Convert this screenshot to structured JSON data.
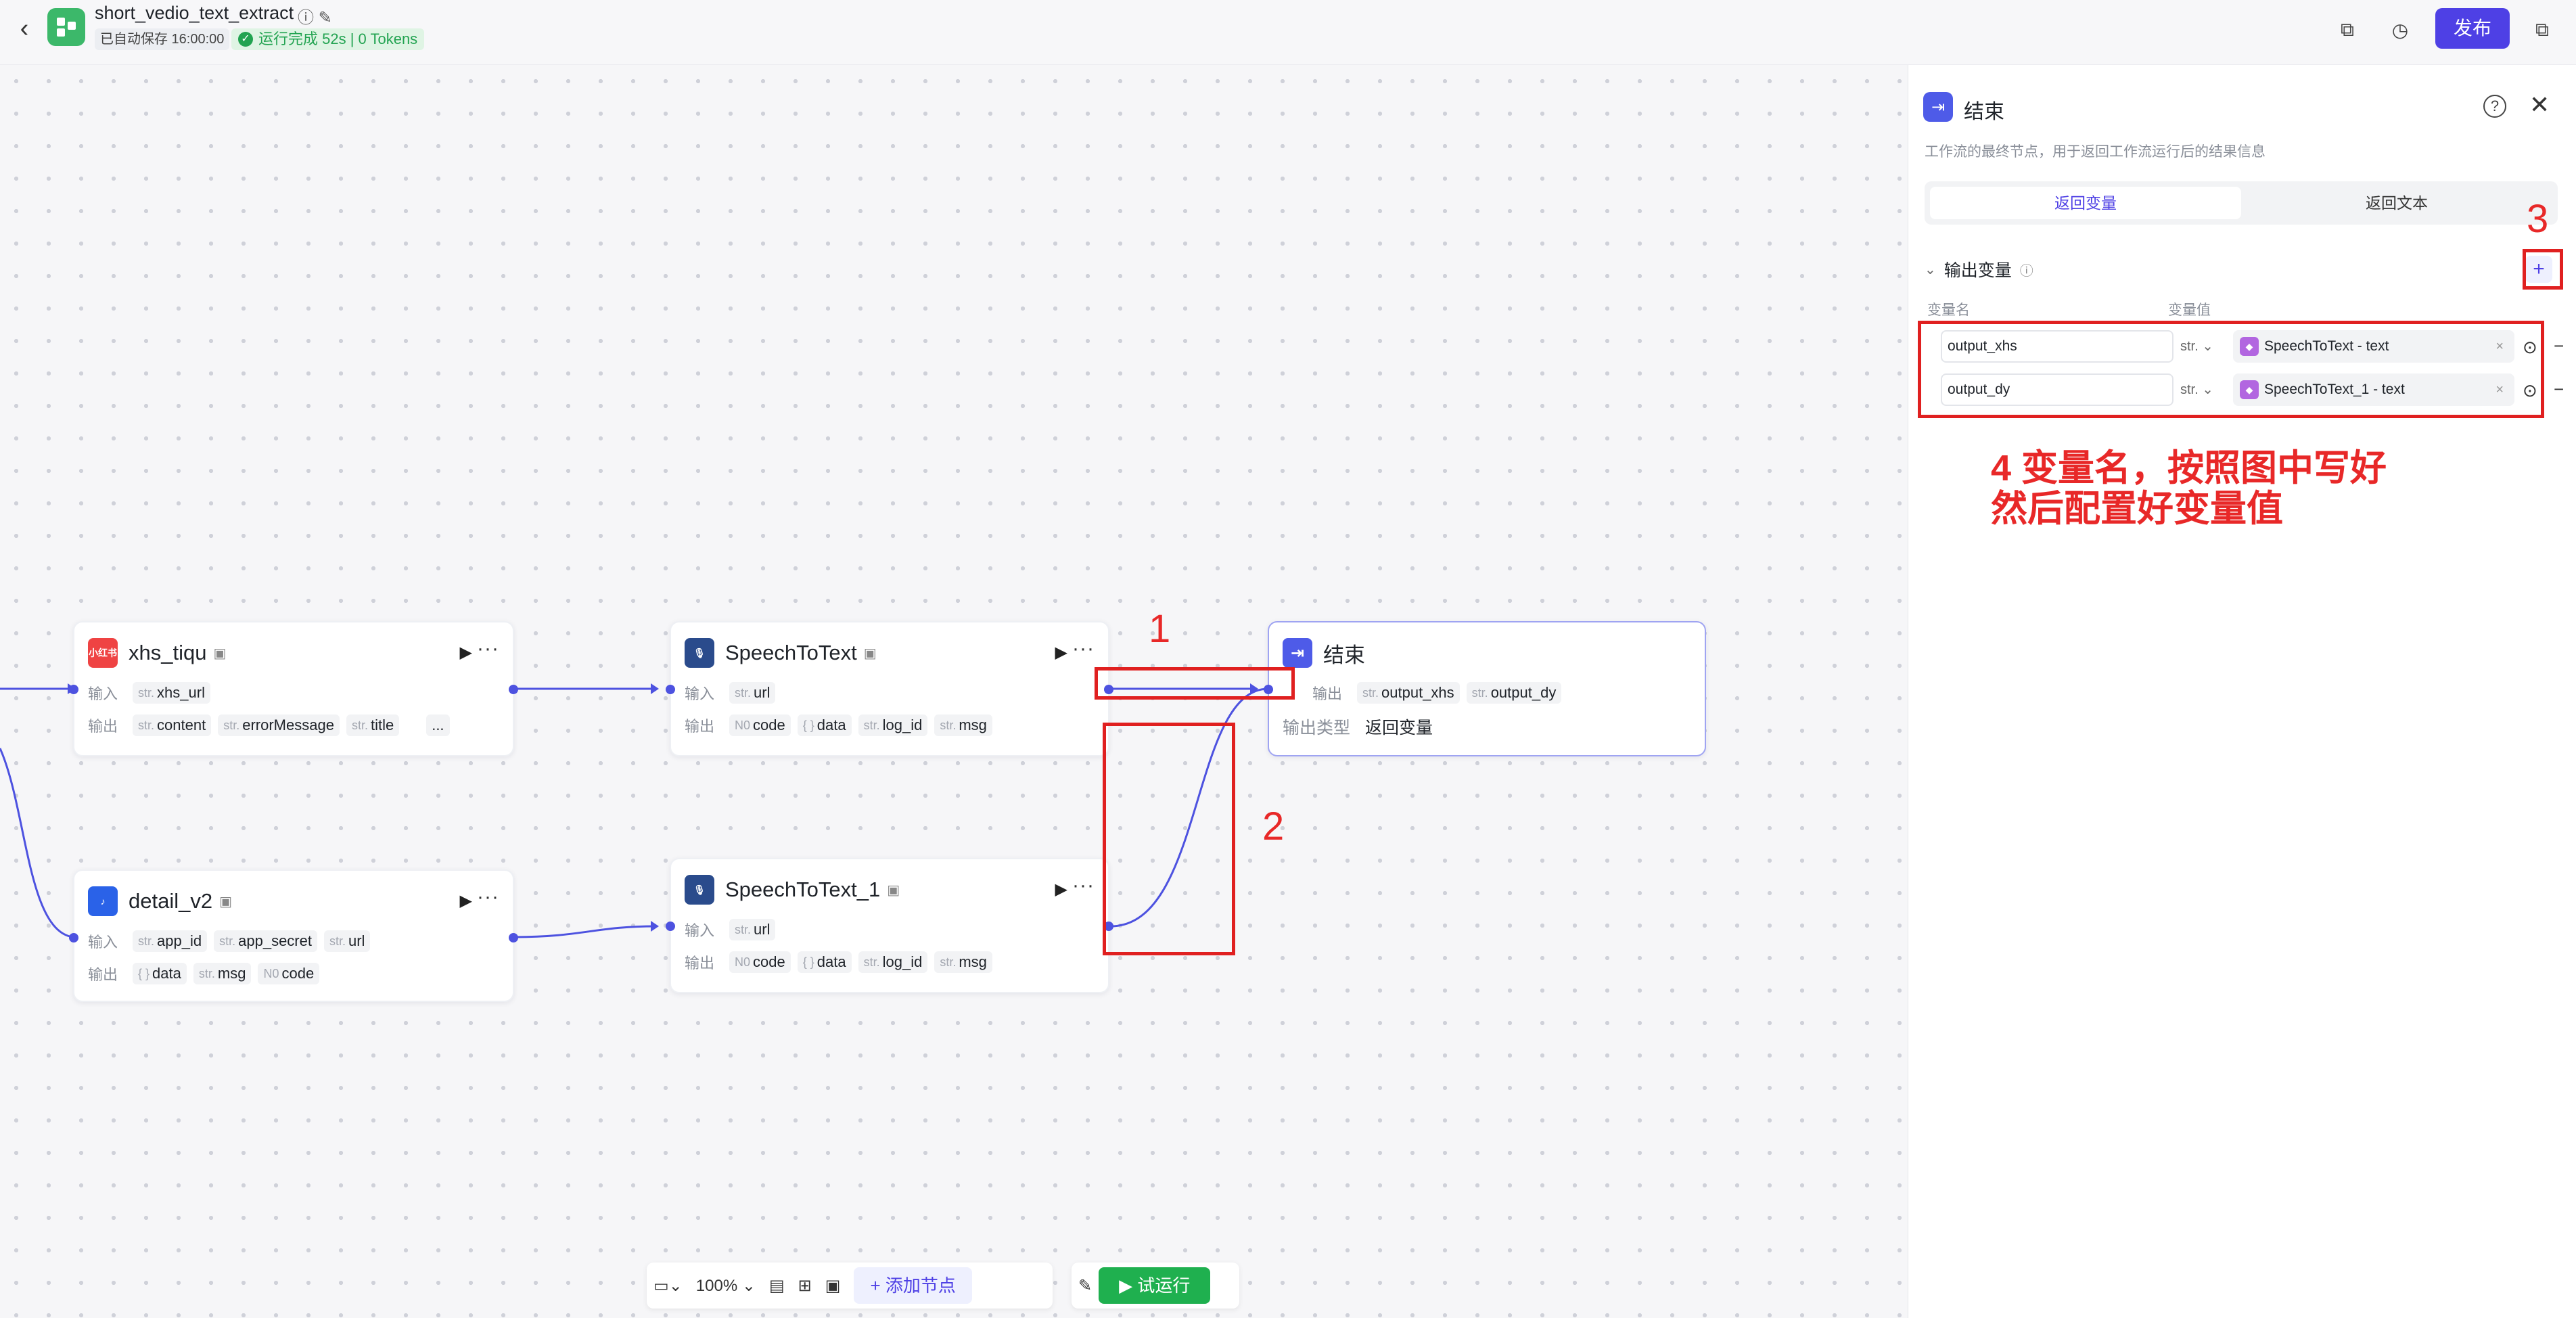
{
  "topbar": {
    "back_icon": "chevron-left-icon",
    "app_title": "short_vedio_text_extract",
    "saved_text": "已自动保存 16:00:00",
    "run_status": "运行完成 52s | 0 Tokens",
    "publish_label": "发布"
  },
  "nodes": {
    "xhs": {
      "title": "xhs_tiqu",
      "input_label": "输入",
      "output_label": "输出",
      "inputs": [
        {
          "type": "str.",
          "name": "xhs_url"
        }
      ],
      "outputs": [
        {
          "type": "str.",
          "name": "content"
        },
        {
          "type": "str.",
          "name": "errorMessage"
        },
        {
          "type": "str.",
          "name": "title"
        }
      ],
      "more": "..."
    },
    "detail": {
      "title": "detail_v2",
      "input_label": "输入",
      "output_label": "输出",
      "inputs": [
        {
          "type": "str.",
          "name": "app_id"
        },
        {
          "type": "str.",
          "name": "app_secret"
        },
        {
          "type": "str.",
          "name": "url"
        }
      ],
      "outputs": [
        {
          "type": "{ }",
          "name": "data"
        },
        {
          "type": "str.",
          "name": "msg"
        },
        {
          "type": "N0",
          "name": "code"
        }
      ]
    },
    "stt": {
      "title": "SpeechToText",
      "input_label": "输入",
      "output_label": "输出",
      "inputs": [
        {
          "type": "str.",
          "name": "url"
        }
      ],
      "outputs": [
        {
          "type": "N0",
          "name": "code"
        },
        {
          "type": "{ }",
          "name": "data"
        },
        {
          "type": "str.",
          "name": "log_id"
        },
        {
          "type": "str.",
          "name": "msg"
        }
      ]
    },
    "stt1": {
      "title": "SpeechToText_1",
      "input_label": "输入",
      "output_label": "输出",
      "inputs": [
        {
          "type": "str.",
          "name": "url"
        }
      ],
      "outputs": [
        {
          "type": "N0",
          "name": "code"
        },
        {
          "type": "{ }",
          "name": "data"
        },
        {
          "type": "str.",
          "name": "log_id"
        },
        {
          "type": "str.",
          "name": "msg"
        }
      ]
    },
    "end": {
      "title": "结束",
      "output_label": "输出",
      "outputs": [
        {
          "type": "str.",
          "name": "output_xhs"
        },
        {
          "type": "str.",
          "name": "output_dy"
        }
      ],
      "output_type_label": "输出类型",
      "output_type_value": "返回变量"
    }
  },
  "panel": {
    "title": "结束",
    "description": "工作流的最终节点，用于返回工作流运行后的结果信息",
    "tabs": [
      "返回变量",
      "返回文本"
    ],
    "section_title": "输出变量",
    "col_name": "变量名",
    "col_value": "变量值",
    "rows": [
      {
        "name": "output_xhs",
        "type": "str.",
        "value": "SpeechToText - text"
      },
      {
        "name": "output_dy",
        "type": "str.",
        "value": "SpeechToText_1 - text"
      }
    ]
  },
  "annotations": {
    "n1": "1",
    "n2": "2",
    "n3": "3",
    "line1": "4 变量名，按照图中写好",
    "line2": "然后配置好变量值",
    "color": "#e82828"
  },
  "toolbar": {
    "zoom": "100%",
    "add_node": "添加节点",
    "test_run": "试运行"
  },
  "colors": {
    "accent": "#4e40e5",
    "run_green": "#1fb04f",
    "edge": "#4d52e0"
  }
}
